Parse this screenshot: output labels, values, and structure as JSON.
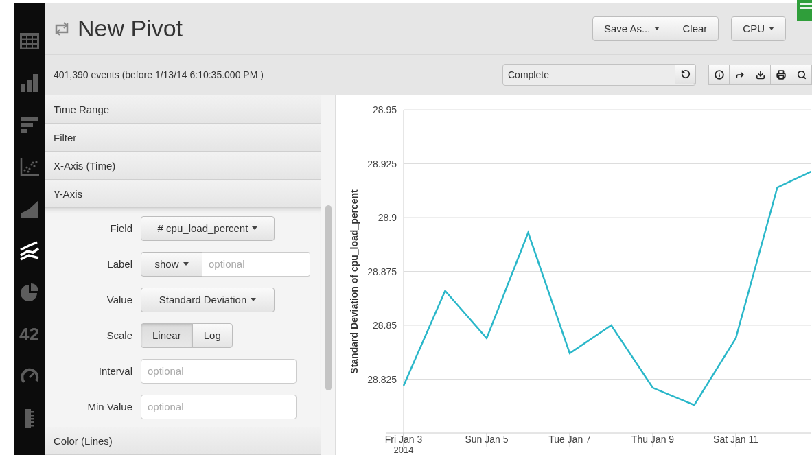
{
  "sidebar": {
    "items": [
      {
        "kind": "table",
        "selected": false
      },
      {
        "kind": "column",
        "selected": false
      },
      {
        "kind": "bar",
        "selected": false
      },
      {
        "kind": "scatter",
        "selected": false
      },
      {
        "kind": "area",
        "selected": false
      },
      {
        "kind": "line",
        "selected": true
      },
      {
        "kind": "pie",
        "selected": false
      },
      {
        "kind": "single_value",
        "label": "42",
        "selected": false
      },
      {
        "kind": "gauge",
        "selected": false
      },
      {
        "kind": "marker_gauge",
        "selected": false
      }
    ]
  },
  "header": {
    "title": "New Pivot",
    "buttons": [
      {
        "label": "Save As...",
        "dropdown": true
      },
      {
        "label": "Clear",
        "dropdown": false
      }
    ],
    "menu": {
      "label": "CPU",
      "dropdown": true
    }
  },
  "status": {
    "events": "401,390 events (before 1/13/14 6:10:35.000 PM )",
    "job": "Complete",
    "tools": [
      {
        "kind": "info"
      },
      {
        "kind": "share"
      },
      {
        "kind": "export"
      },
      {
        "kind": "print"
      },
      {
        "kind": "inspect"
      }
    ]
  },
  "panels": [
    {
      "title": "Time Range"
    },
    {
      "title": "Filter"
    },
    {
      "title": "X-Axis (Time)"
    },
    {
      "title": "Y-Axis",
      "fields": [
        {
          "kind": "dropdown",
          "label": "Field",
          "value": "# cpu_load_percent"
        },
        {
          "kind": "combo",
          "label": "Label",
          "value": "show",
          "placeholder": "optional"
        },
        {
          "kind": "dropdown",
          "label": "Value",
          "value": "Standard Deviation"
        },
        {
          "kind": "segmented",
          "label": "Scale",
          "options": [
            {
              "label": "Linear",
              "selected": true
            },
            {
              "label": "Log",
              "selected": false
            }
          ]
        },
        {
          "kind": "input",
          "label": "Interval",
          "placeholder": "optional"
        },
        {
          "kind": "input",
          "label": "Min Value",
          "placeholder": "optional"
        }
      ]
    },
    {
      "title": "Color (Lines)"
    }
  ],
  "chart": {
    "chart_data": {
      "type": "line",
      "ylabel": "Standard Deviation of cpu_load_percent",
      "categories": [
        "Fri Jan 3",
        null,
        "Sun Jan 5",
        null,
        "Tue Jan 7",
        null,
        "Thu Jan 9",
        null,
        "Sat Jan 11",
        null,
        null
      ],
      "grid": true,
      "series": [
        {
          "color": "#2ab7c9",
          "values": [
            28.822,
            28.866,
            28.844,
            28.893,
            28.837,
            28.85,
            28.821,
            28.813,
            28.844,
            28.914,
            28.923
          ]
        }
      ],
      "ylim": [
        28.8,
        28.95
      ],
      "yticks": [
        28.825,
        28.85,
        28.875,
        28.9,
        28.925,
        28.95
      ],
      "annotations": [
        "2014"
      ]
    }
  }
}
